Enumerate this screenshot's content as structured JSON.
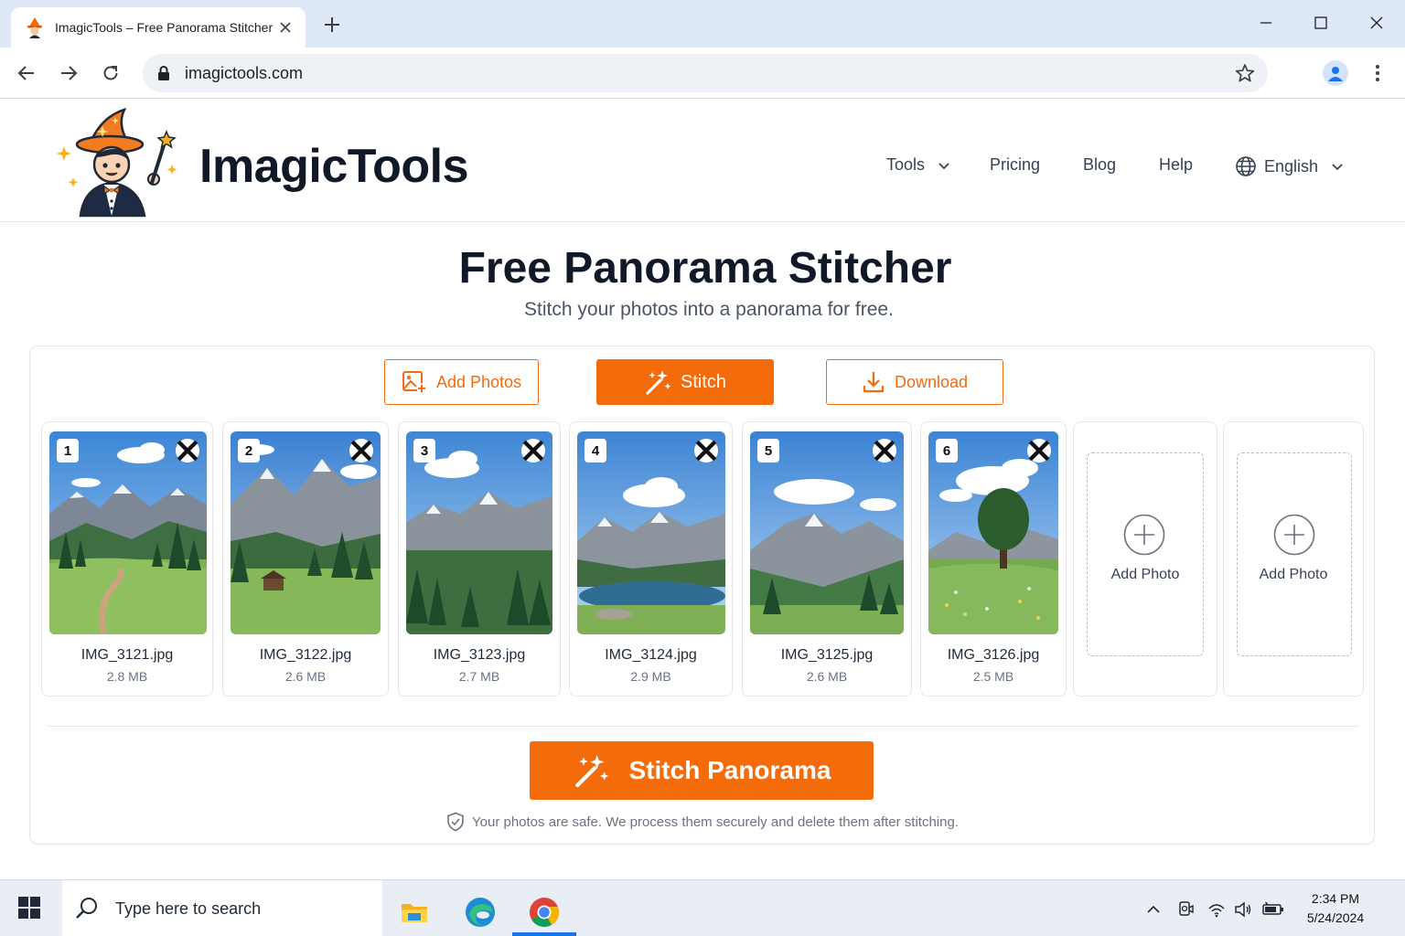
{
  "browser": {
    "tab_title": "ImagicTools – Free Panorama Stitcher",
    "url": "imagictools.com"
  },
  "site": {
    "brand": "ImagicTools",
    "nav": {
      "tools": "Tools",
      "pricing": "Pricing",
      "blog": "Blog",
      "help": "Help",
      "language": "English"
    }
  },
  "hero": {
    "title": "Free Panorama Stitcher",
    "subtitle": "Stitch your photos into a panorama for free."
  },
  "actions": {
    "add_photos": "Add Photos",
    "stitch": "Stitch",
    "download": "Download"
  },
  "photos": [
    {
      "num": "1",
      "name": "IMG_3121.jpg",
      "size": "2.8 MB"
    },
    {
      "num": "2",
      "name": "IMG_3122.jpg",
      "size": "2.6 MB"
    },
    {
      "num": "3",
      "name": "IMG_3123.jpg",
      "size": "2.7 MB"
    },
    {
      "num": "4",
      "name": "IMG_3124.jpg",
      "size": "2.9 MB"
    },
    {
      "num": "5",
      "name": "IMG_3125.jpg",
      "size": "2.6 MB"
    },
    {
      "num": "6",
      "name": "IMG_3126.jpg",
      "size": "2.5 MB"
    }
  ],
  "add_slots": [
    {
      "label": "Add Photo"
    },
    {
      "label": "Add Photo"
    }
  ],
  "stitch_panorama": "Stitch Panorama",
  "safe_note": "Your photos are safe. We process them securely and delete them after stitching.",
  "taskbar": {
    "search_placeholder": "Type here to search",
    "time": "2:34 PM",
    "date": "5/24/2024"
  },
  "colors": {
    "accent": "#f46b0c",
    "text_dark": "#111827",
    "chrome_bg": "#dfe8f7"
  }
}
